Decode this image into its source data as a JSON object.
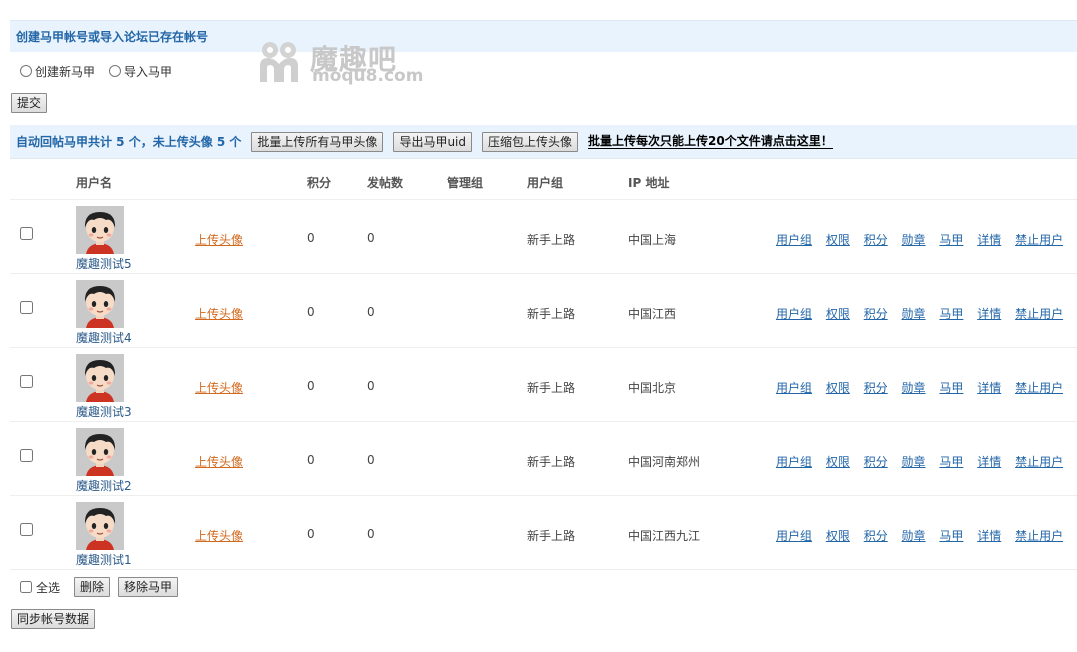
{
  "header": {
    "title": "创建马甲帐号或导入论坛已存在帐号"
  },
  "watermark": {
    "title": "魔趣吧",
    "url": "moqu8.com"
  },
  "create_options": {
    "option_create": "创建新马甲",
    "option_import": "导入马甲",
    "submit_label": "提交"
  },
  "toolbar": {
    "summary": "自动回帖马甲共计 5 个，未上传头像 5 个",
    "batch_upload_label": "批量上传所有马甲头像",
    "export_uid_label": "导出马甲uid",
    "zip_upload_label": "压缩包上传头像",
    "batch_note_link": "批量上传每次只能上传20个文件请点击这里！"
  },
  "table": {
    "headers": {
      "username": "用户名",
      "credits": "积分",
      "posts": "发帖数",
      "admin_group": "管理组",
      "user_group": "用户组",
      "ip_location": "IP 地址"
    },
    "rows": [
      {
        "name": "魔趣测试5",
        "upload": "上传头像",
        "credits": "0",
        "posts": "0",
        "admin_group": "",
        "user_group": "新手上路",
        "ip": "中国上海"
      },
      {
        "name": "魔趣测试4",
        "upload": "上传头像",
        "credits": "0",
        "posts": "0",
        "admin_group": "",
        "user_group": "新手上路",
        "ip": "中国江西"
      },
      {
        "name": "魔趣测试3",
        "upload": "上传头像",
        "credits": "0",
        "posts": "0",
        "admin_group": "",
        "user_group": "新手上路",
        "ip": "中国北京"
      },
      {
        "name": "魔趣测试2",
        "upload": "上传头像",
        "credits": "0",
        "posts": "0",
        "admin_group": "",
        "user_group": "新手上路",
        "ip": "中国河南郑州"
      },
      {
        "name": "魔趣测试1",
        "upload": "上传头像",
        "credits": "0",
        "posts": "0",
        "admin_group": "",
        "user_group": "新手上路",
        "ip": "中国江西九江"
      }
    ],
    "actions": {
      "user_group": "用户组",
      "permissions": "权限",
      "credits": "积分",
      "medals": "勋章",
      "vest": "马甲",
      "details": "详情",
      "ban": "禁止用户"
    }
  },
  "footer": {
    "select_all": "全选",
    "delete_label": "删除",
    "remove_vest_label": "移除马甲",
    "sync_label": "同步帐号数据"
  },
  "colors": {
    "header_bg": "#e8f3fd",
    "header_text": "#2366a8",
    "upload_link": "#d2691e",
    "action_link": "#2366a8"
  }
}
